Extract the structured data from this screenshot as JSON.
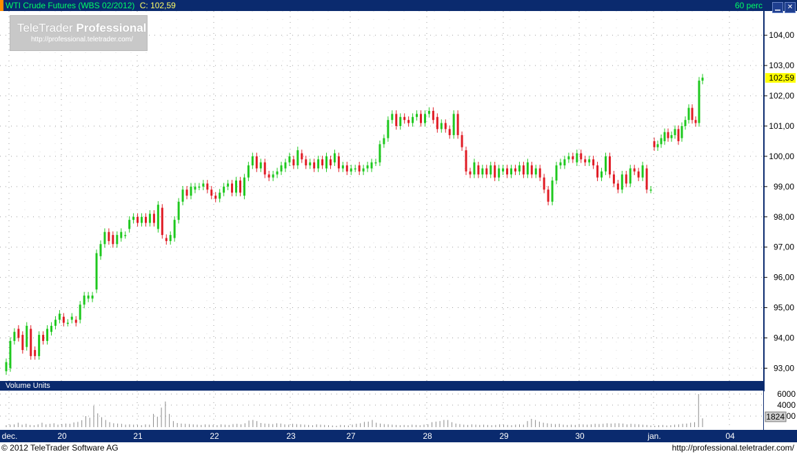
{
  "header": {
    "instrument": "WTI Crude Futures (WBS 02/2012)",
    "close_label": "C: 102,59",
    "period": "60 perc"
  },
  "logo": {
    "brand_light": "TeleTrader",
    "brand_bold": "Professional",
    "url": "http://professional.teletrader.com/"
  },
  "volume": {
    "title": "Volume Units",
    "current_label": "1824",
    "ticks": [
      "6000",
      "4000",
      "2000"
    ]
  },
  "footer": {
    "copyright": "© 2012 TeleTrader Software AG",
    "url": "http://professional.teletrader.com/"
  },
  "colors": {
    "up": "#1ec81e",
    "down": "#e01b24",
    "panel": "#0a2a6e",
    "last_price": "#ffff00"
  },
  "chart_data": {
    "type": "candlestick",
    "price_ticks": [
      "93,00",
      "94,00",
      "95,00",
      "96,00",
      "97,00",
      "98,00",
      "99,00",
      "100,00",
      "101,00",
      "102,00",
      "103,00",
      "104,00"
    ],
    "ylim": [
      92.6,
      104.8
    ],
    "last_price": "102,59",
    "x_labels": [
      "dec.",
      "20",
      "21",
      "22",
      "23",
      "27",
      "28",
      "29",
      "30",
      "jan.",
      "04"
    ],
    "session_close_segment": [
      [
        92.9,
        93.2
      ],
      [
        93.0,
        93.9
      ],
      [
        93.9,
        94.2
      ],
      [
        94.3,
        94.0
      ],
      [
        94.1,
        93.6
      ],
      [
        93.7,
        94.4
      ],
      [
        94.3,
        93.4
      ],
      [
        93.6,
        93.4
      ],
      [
        93.4,
        94.1
      ],
      [
        94.1,
        93.9
      ],
      [
        93.9,
        94.3
      ],
      [
        94.2,
        94.4
      ],
      [
        94.4,
        94.6
      ],
      [
        94.6,
        94.8
      ],
      [
        94.7,
        94.5
      ],
      [
        94.5,
        94.5
      ],
      [
        94.6,
        94.7
      ],
      [
        94.6,
        94.5
      ],
      [
        94.6,
        95.1
      ],
      [
        95.1,
        95.4
      ],
      [
        95.3,
        95.4
      ],
      [
        95.3,
        95.4
      ],
      [
        95.6,
        96.8
      ],
      [
        96.7,
        97.1
      ],
      [
        97.1,
        97.5
      ],
      [
        97.5,
        97.2
      ],
      [
        97.4,
        97.1
      ],
      [
        97.1,
        97.4
      ],
      [
        97.3,
        97.5
      ],
      [
        97.4,
        97.4
      ],
      [
        97.6,
        97.9
      ],
      [
        97.9,
        98.0
      ],
      [
        98.0,
        97.8
      ],
      [
        97.8,
        98.0
      ],
      [
        98.0,
        97.8
      ],
      [
        97.8,
        98.1
      ],
      [
        98.1,
        97.8
      ],
      [
        97.6,
        98.4
      ],
      [
        98.3,
        97.4
      ],
      [
        97.3,
        97.2
      ],
      [
        97.2,
        97.4
      ],
      [
        97.3,
        97.9
      ],
      [
        97.9,
        98.5
      ],
      [
        98.5,
        98.9
      ],
      [
        98.9,
        98.7
      ],
      [
        98.7,
        99.0
      ],
      [
        98.9,
        99.0
      ],
      [
        99.0,
        99.0
      ],
      [
        99.0,
        99.1
      ],
      [
        99.1,
        98.9
      ],
      [
        98.9,
        98.7
      ],
      [
        98.7,
        98.6
      ],
      [
        98.6,
        98.8
      ],
      [
        98.8,
        99.0
      ],
      [
        99.0,
        99.1
      ],
      [
        99.1,
        98.8
      ],
      [
        98.8,
        99.2
      ],
      [
        99.2,
        98.8
      ],
      [
        98.7,
        99.3
      ],
      [
        99.3,
        99.7
      ],
      [
        99.7,
        100.0
      ],
      [
        100.0,
        99.6
      ],
      [
        99.6,
        99.8
      ],
      [
        99.8,
        99.4
      ],
      [
        99.4,
        99.3
      ],
      [
        99.3,
        99.4
      ],
      [
        99.4,
        99.5
      ],
      [
        99.5,
        99.7
      ],
      [
        99.6,
        99.8
      ],
      [
        99.8,
        100.0
      ],
      [
        99.9,
        99.7
      ],
      [
        99.7,
        100.2
      ],
      [
        100.1,
        99.9
      ],
      [
        99.9,
        99.7
      ],
      [
        99.7,
        99.8
      ],
      [
        99.8,
        99.6
      ],
      [
        99.6,
        99.9
      ],
      [
        99.9,
        99.7
      ],
      [
        99.6,
        100.0
      ],
      [
        99.9,
        99.7
      ],
      [
        99.8,
        100.1
      ],
      [
        100.0,
        99.6
      ],
      [
        99.6,
        99.7
      ],
      [
        99.7,
        99.5
      ],
      [
        99.5,
        99.6
      ],
      [
        99.6,
        99.6
      ],
      [
        99.7,
        99.5
      ],
      [
        99.5,
        99.6
      ],
      [
        99.6,
        99.7
      ],
      [
        99.6,
        99.8
      ],
      [
        99.8,
        99.8
      ],
      [
        99.8,
        100.4
      ],
      [
        100.4,
        100.6
      ],
      [
        100.6,
        101.2
      ],
      [
        101.2,
        101.4
      ],
      [
        101.4,
        101.0
      ],
      [
        101.0,
        101.3
      ],
      [
        101.3,
        101.2
      ],
      [
        101.2,
        101.1
      ],
      [
        101.1,
        101.3
      ],
      [
        101.3,
        101.4
      ],
      [
        101.4,
        101.1
      ],
      [
        101.1,
        101.4
      ],
      [
        101.4,
        101.5
      ],
      [
        101.5,
        101.2
      ],
      [
        101.3,
        100.9
      ],
      [
        100.9,
        101.1
      ],
      [
        101.1,
        100.9
      ],
      [
        100.9,
        100.7
      ],
      [
        100.7,
        101.4
      ],
      [
        101.4,
        100.7
      ],
      [
        100.7,
        100.3
      ],
      [
        100.2,
        99.5
      ],
      [
        99.5,
        99.4
      ],
      [
        99.4,
        99.8
      ],
      [
        99.7,
        99.4
      ],
      [
        99.4,
        99.6
      ],
      [
        99.6,
        99.4
      ],
      [
        99.4,
        99.7
      ],
      [
        99.7,
        99.3
      ],
      [
        99.3,
        99.6
      ],
      [
        99.5,
        99.6
      ],
      [
        99.6,
        99.4
      ],
      [
        99.4,
        99.6
      ],
      [
        99.6,
        99.5
      ],
      [
        99.5,
        99.7
      ],
      [
        99.7,
        99.4
      ],
      [
        99.4,
        99.8
      ],
      [
        99.7,
        99.4
      ],
      [
        99.4,
        99.6
      ],
      [
        99.6,
        99.3
      ],
      [
        99.3,
        98.9
      ],
      [
        98.9,
        98.5
      ],
      [
        98.5,
        99.2
      ],
      [
        99.2,
        99.7
      ],
      [
        99.7,
        99.8
      ],
      [
        99.7,
        99.9
      ],
      [
        99.9,
        100.0
      ],
      [
        100.0,
        99.9
      ],
      [
        99.8,
        100.1
      ],
      [
        100.1,
        99.9
      ],
      [
        99.9,
        99.8
      ],
      [
        99.8,
        99.9
      ],
      [
        99.9,
        99.7
      ],
      [
        99.7,
        99.3
      ],
      [
        99.3,
        99.5
      ],
      [
        99.5,
        100.0
      ],
      [
        100.0,
        99.4
      ],
      [
        99.4,
        99.1
      ],
      [
        99.1,
        98.9
      ],
      [
        98.9,
        99.4
      ],
      [
        99.4,
        99.1
      ],
      [
        99.1,
        99.6
      ],
      [
        99.6,
        99.5
      ],
      [
        99.5,
        99.3
      ],
      [
        99.3,
        99.7
      ],
      [
        99.6,
        98.9
      ],
      [
        98.9,
        98.9
      ]
    ],
    "new_year_segment": [
      [
        100.5,
        100.3
      ],
      [
        100.3,
        100.4
      ],
      [
        100.4,
        100.6
      ],
      [
        100.5,
        100.8
      ],
      [
        100.8,
        100.6
      ],
      [
        100.6,
        100.7
      ],
      [
        100.7,
        100.9
      ],
      [
        100.9,
        100.5
      ],
      [
        100.6,
        101.0
      ],
      [
        101.0,
        101.2
      ],
      [
        101.2,
        101.6
      ],
      [
        101.6,
        101.2
      ],
      [
        101.2,
        101.1
      ],
      [
        101.1,
        102.5
      ],
      [
        102.5,
        102.6
      ]
    ],
    "volume": [
      350,
      450,
      500,
      800,
      450,
      600,
      400,
      350,
      500,
      800,
      500,
      600,
      700,
      450,
      550,
      650,
      600,
      850,
      950,
      1250,
      2000,
      1700,
      3900,
      2500,
      1800,
      1300,
      900,
      700,
      650,
      600,
      450,
      500,
      450,
      400,
      350,
      500,
      450,
      2400,
      1900,
      3550,
      4650,
      2400,
      1100,
      750,
      650,
      600,
      550,
      500,
      450,
      400,
      500,
      450,
      400,
      350,
      500,
      450,
      400,
      550,
      600,
      500,
      700,
      1200,
      1300,
      1100,
      750,
      650,
      600,
      550,
      700,
      650,
      500,
      450,
      600,
      550,
      500,
      450,
      400,
      350,
      500,
      450,
      400,
      350,
      300,
      250,
      400,
      350,
      300,
      450,
      600,
      700,
      950,
      1000,
      1300,
      800,
      650,
      550,
      500,
      450,
      400,
      350,
      400,
      350,
      450,
      400,
      350,
      450,
      500,
      900,
      1000,
      1100,
      1300,
      1300,
      900,
      650,
      550,
      450,
      400,
      500,
      450,
      400,
      450,
      400,
      350,
      400,
      500,
      450,
      400,
      350,
      450,
      500,
      450,
      1100,
      1500,
      1300,
      1000,
      800,
      700,
      600,
      550,
      600,
      450,
      400,
      450,
      400,
      550,
      500,
      450,
      500,
      600,
      550,
      600,
      700,
      650,
      700,
      700,
      650,
      500,
      600,
      550,
      500,
      450,
      400,
      300,
      250,
      350,
      400,
      300,
      350,
      450,
      500,
      600,
      650,
      800,
      900,
      6000,
      1600
    ]
  }
}
